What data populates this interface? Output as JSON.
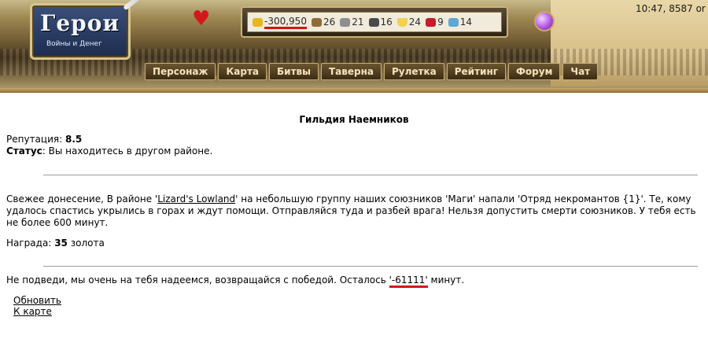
{
  "header": {
    "logo_title": "Герои",
    "logo_subtitle": "Войны и Денег",
    "clock": "10:47, 8587 or",
    "resources": [
      {
        "name": "gold",
        "value": "-300,950"
      },
      {
        "name": "wood",
        "value": "26"
      },
      {
        "name": "ore",
        "value": "21"
      },
      {
        "name": "mercury",
        "value": "16"
      },
      {
        "name": "sulfur",
        "value": "24"
      },
      {
        "name": "crystals",
        "value": "9"
      },
      {
        "name": "gems",
        "value": "14"
      }
    ],
    "nav": [
      "Персонаж",
      "Карта",
      "Битвы",
      "Таверна",
      "Рулетка",
      "Рейтинг",
      "Форум",
      "Чат"
    ]
  },
  "main": {
    "title": "Гильдия Наемников",
    "reputation_label": "Репутация:",
    "reputation_value": "8.5",
    "status_label": "Статус",
    "status_text": ": Вы находитесь в другом районе.",
    "news_part1": "Свежее донесение, В районе '",
    "news_location": "Lizard's Lowland",
    "news_part2": "' на небольшую группу наших союзников 'Маги' напали 'Отряд некромантов {1}'. Те, кому удалось спастись укрылись в горах и ждут помощи. Отправляйся туда и разбей врага! Нельзя допустить смерти союзников. У тебя есть не более 600 минут.",
    "reward_label": "Награда:",
    "reward_value": "35",
    "reward_unit": "золота",
    "warning_part1": "Не подведи, мы очень на тебя надеемся, возвращайся с победой. Осталось ",
    "warning_minutes": "'-61111'",
    "warning_part2": " минут.",
    "link_refresh": "Обновить",
    "link_map": "К карте"
  },
  "colors": {
    "accent_red": "#d41515",
    "gold_border": "#c9b070"
  }
}
